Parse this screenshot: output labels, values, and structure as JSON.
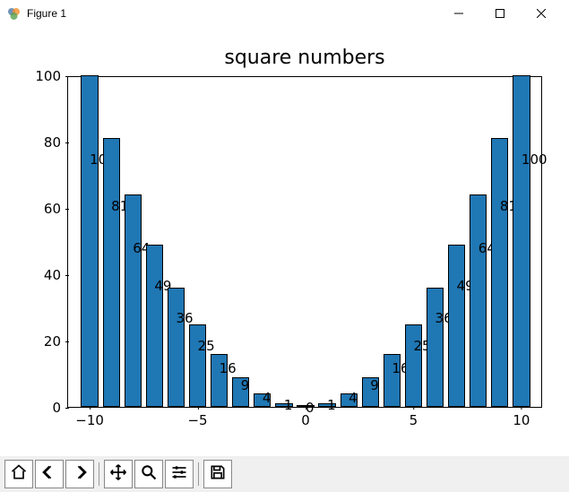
{
  "window": {
    "title": "Figure 1",
    "minimize_btn": "minimize",
    "maximize_btn": "maximize",
    "close_btn": "close"
  },
  "chart_data": {
    "type": "bar",
    "title": "square numbers",
    "xlabel": "",
    "ylabel": "",
    "xlim": [
      -11,
      11
    ],
    "ylim": [
      0,
      100
    ],
    "xticks": [
      -10,
      -5,
      0,
      5,
      10
    ],
    "yticks": [
      0,
      20,
      40,
      60,
      80,
      100
    ],
    "categories": [
      -10,
      -9,
      -8,
      -7,
      -6,
      -5,
      -4,
      -3,
      -2,
      -1,
      0,
      1,
      2,
      3,
      4,
      5,
      6,
      7,
      8,
      9,
      10
    ],
    "values": [
      100,
      81,
      64,
      49,
      36,
      25,
      16,
      9,
      4,
      1,
      0,
      1,
      4,
      9,
      16,
      25,
      36,
      49,
      64,
      81,
      100
    ],
    "bar_labels": [
      "100",
      "81",
      "64",
      "49",
      "36",
      "25",
      "16",
      "9",
      "4",
      "1",
      "0",
      "1",
      "4",
      "9",
      "16",
      "25",
      "36",
      "49",
      "64",
      "81",
      "100"
    ],
    "bar_color": "#1f77b4"
  },
  "toolbar": {
    "home": "home",
    "back": "back",
    "forward": "forward",
    "pan": "pan",
    "zoom": "zoom",
    "configure": "configure-subplots",
    "save": "save"
  }
}
